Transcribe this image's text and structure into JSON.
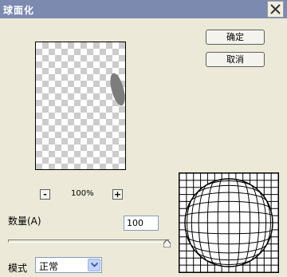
{
  "window": {
    "title": "球面化"
  },
  "buttons": {
    "ok_label": "确定",
    "cancel_label": "取消"
  },
  "zoom": {
    "out_label": "-",
    "level": "100%",
    "in_label": "+"
  },
  "amount": {
    "label": "数量(A)",
    "value": "100",
    "unit": "%",
    "slider_fraction": 1.0
  },
  "mode": {
    "label": "模式",
    "value": "正常"
  },
  "icons": {
    "close": "close-icon",
    "dropdown": "chevron-down-icon",
    "slider": "slider-triangle-thumb"
  },
  "colors": {
    "titlebar": "#7C8AB0",
    "dialog_bg": "#ECE9D8",
    "checker": "#CCCCCC",
    "distorted_shape": "#7D7D7D"
  }
}
